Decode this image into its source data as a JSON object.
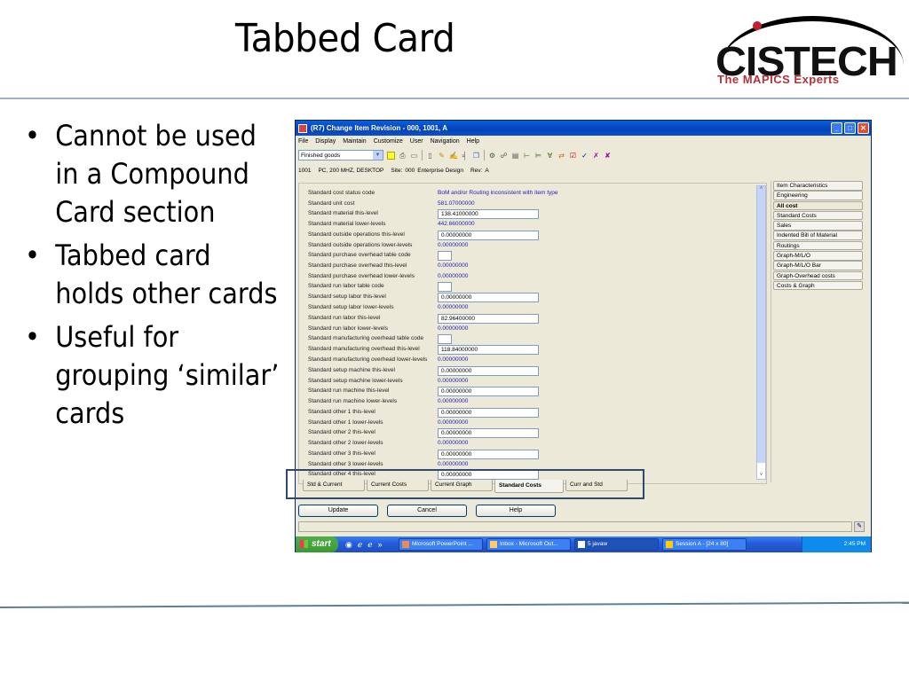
{
  "slide": {
    "title": "Tabbed Card",
    "logo": {
      "name": "CISTECH",
      "tagline": "The MAPICS Experts"
    },
    "bullets": [
      "Cannot be used in a Compound Card section",
      "Tabbed card holds other cards",
      "Useful for grouping ‘similar’ cards"
    ]
  },
  "window": {
    "title": "(R7) Change Item Revision - 000, 1001, A",
    "controls": {
      "minimize": "_",
      "maximize": "□",
      "close": "✕"
    },
    "menu": [
      "File",
      "Display",
      "Maintain",
      "Customize",
      "User",
      "Navigation",
      "Help"
    ],
    "toolbar": {
      "combo_value": "Finished goods",
      "icons": [
        "note-icon",
        "print-preview-icon",
        "print-icon",
        "new-icon",
        "edit-icon",
        "edit-list-icon",
        "tools-icon",
        "copy-icon",
        "query-icon",
        "link-icon",
        "structure-icon",
        "tree-icon",
        "tree2-icon",
        "where-used-icon",
        "routing-icon",
        "check1-icon",
        "check2-icon",
        "check3-icon",
        "check4-icon"
      ]
    },
    "info": {
      "item": "1001",
      "description": "PC, 200 MHZ, DESKTOP",
      "site_label": "Site:",
      "site": "000",
      "site_name": "Enterprise Design",
      "rev_label": "Rev:",
      "rev": "A"
    },
    "fields": [
      {
        "label": "Standard cost status code",
        "value": "BoM and/or Routing inconsistent with item type",
        "type": "text"
      },
      {
        "label": "Standard unit cost",
        "value": "581.07000000",
        "type": "text"
      },
      {
        "label": "Standard material this-level",
        "value": "138.41000000",
        "type": "input"
      },
      {
        "label": "Standard material lower-levels",
        "value": "442.66000000",
        "type": "text"
      },
      {
        "label": "Standard outside operations this-level",
        "value": "0.00000000",
        "type": "input"
      },
      {
        "label": "Standard outside operations lower-levels",
        "value": "0.00000000",
        "type": "text"
      },
      {
        "label": "Standard purchase overhead table code",
        "value": "",
        "type": "small"
      },
      {
        "label": "Standard purchase overhead this-level",
        "value": "0.00000000",
        "type": "text"
      },
      {
        "label": "Standard purchase overhead lower-levels",
        "value": "0.00000000",
        "type": "text"
      },
      {
        "label": "Standard run labor table code",
        "value": "",
        "type": "small"
      },
      {
        "label": "Standard setup labor this-level",
        "value": "0.00000000",
        "type": "input"
      },
      {
        "label": "Standard setup labor lower-levels",
        "value": "0.00000000",
        "type": "text"
      },
      {
        "label": "Standard run labor this-level",
        "value": "82.96400000",
        "type": "input"
      },
      {
        "label": "Standard run labor lower-levels",
        "value": "0.00000000",
        "type": "text"
      },
      {
        "label": "Standard manufacturing overhead table code",
        "value": "",
        "type": "small"
      },
      {
        "label": "Standard manufacturing overhead this-level",
        "value": "118.84000000",
        "type": "input"
      },
      {
        "label": "Standard manufacturing overhead lower-levels",
        "value": "0.00000000",
        "type": "text"
      },
      {
        "label": "Standard setup machine this-level",
        "value": "0.00000000",
        "type": "input"
      },
      {
        "label": "Standard setup machine lower-levels",
        "value": "0.00000000",
        "type": "text"
      },
      {
        "label": "Standard run machine this-level",
        "value": "0.00000000",
        "type": "input"
      },
      {
        "label": "Standard run machine lower-levels",
        "value": "0.00000000",
        "type": "text"
      },
      {
        "label": "Standard other 1 this-level",
        "value": "0.00000000",
        "type": "input"
      },
      {
        "label": "Standard other 1 lower-levels",
        "value": "0.00000000",
        "type": "text"
      },
      {
        "label": "Standard other 2 this-level",
        "value": "0.00000000",
        "type": "input"
      },
      {
        "label": "Standard other 2 lower-levels",
        "value": "0.00000000",
        "type": "text"
      },
      {
        "label": "Standard other 3 this-level",
        "value": "0.00000000",
        "type": "input"
      },
      {
        "label": "Standard other 3 lower-levels",
        "value": "0.00000000",
        "type": "text"
      },
      {
        "label": "Standard other 4 this-level",
        "value": "0.00000000",
        "type": "input"
      }
    ],
    "side_tabs": [
      {
        "label": "Item Characteristics",
        "active": false
      },
      {
        "label": "Engineering",
        "active": false
      },
      {
        "label": "All cost",
        "active": true
      },
      {
        "label": "Standard Costs",
        "active": false
      },
      {
        "label": "Sales",
        "active": false
      },
      {
        "label": "Indented Bill of Material",
        "active": false
      },
      {
        "label": "Routings",
        "active": false
      },
      {
        "label": "Graph-M/L/O",
        "active": false
      },
      {
        "label": "Graph-M/L/O Bar",
        "active": false
      },
      {
        "label": "Graph-Overhead costs",
        "active": false
      },
      {
        "label": "Costs & Graph",
        "active": false
      }
    ],
    "bottom_tabs": [
      {
        "label": "Std & Current",
        "active": false
      },
      {
        "label": "Current Costs",
        "active": false
      },
      {
        "label": "Current Graph",
        "active": false
      },
      {
        "label": "Standard Costs",
        "active": true
      },
      {
        "label": "Curr and Std",
        "active": false
      }
    ],
    "buttons": {
      "update": "Update",
      "cancel": "Cancel",
      "help": "Help"
    },
    "scroll": {
      "up": "˄",
      "down": "˅"
    }
  },
  "taskbar": {
    "start": "start",
    "tasks": [
      {
        "label": "Microsoft PowerPoint ...",
        "active": false
      },
      {
        "label": "Inbox - Microsoft Out...",
        "active": false
      },
      {
        "label": "5 javaw",
        "active": true
      },
      {
        "label": "Session A - [24 x 80]",
        "active": false
      }
    ],
    "clock": "2:45 PM"
  },
  "colors": {
    "accent": "#0a5fdc",
    "link_value": "#2020c0",
    "highlight_box": "#2d4a70"
  }
}
